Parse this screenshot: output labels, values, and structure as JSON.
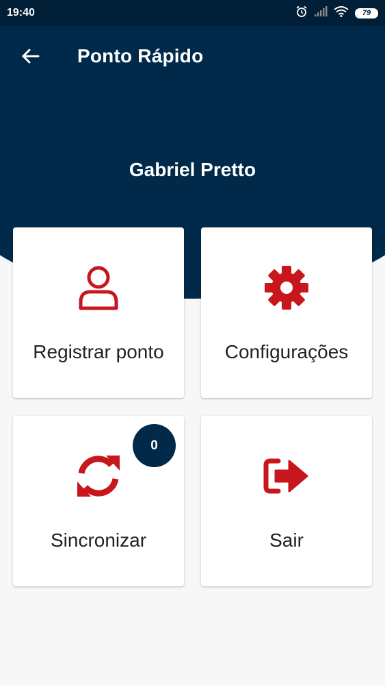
{
  "status_bar": {
    "time": "19:40",
    "battery": "79"
  },
  "app_bar": {
    "title": "Ponto Rápido"
  },
  "user": {
    "name": "Gabriel Pretto"
  },
  "menu": {
    "register": "Registrar ponto",
    "settings": "Configurações",
    "sync": "Sincronizar",
    "sync_badge": "0",
    "logout": "Sair"
  },
  "colors": {
    "primary": "#012a4a",
    "accent": "#c8161d",
    "background": "#f7f7f8"
  },
  "icons": {
    "register": "user-icon",
    "settings": "gear-icon",
    "sync": "sync-icon",
    "logout": "sign-out-icon"
  }
}
